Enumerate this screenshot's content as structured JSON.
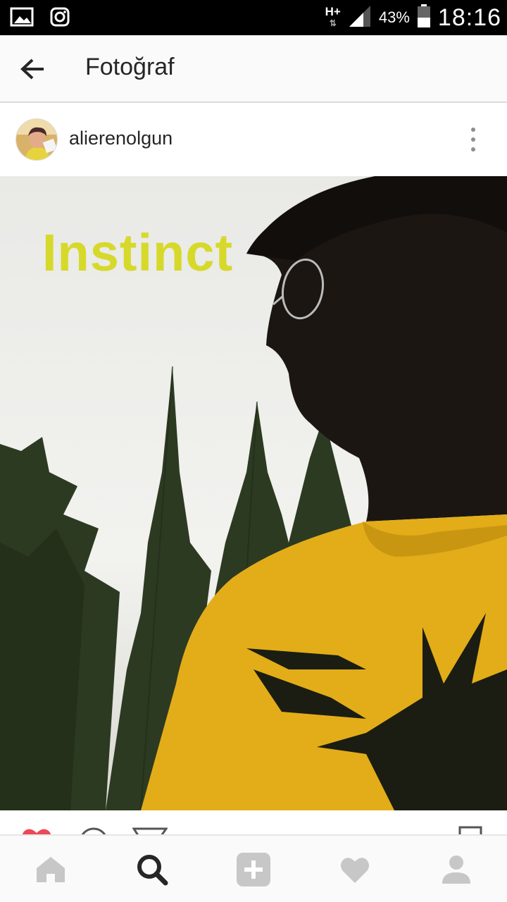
{
  "status_bar": {
    "network_type": "H+",
    "battery_percent": "43%",
    "time": "18:16",
    "icons": [
      "gallery-icon",
      "instagram-icon",
      "signal-icon",
      "battery-icon"
    ]
  },
  "header": {
    "title": "Fotoğraf",
    "back_icon": "arrow-left-icon"
  },
  "post": {
    "username": "alierenolgun",
    "menu_icon": "more-vertical-icon",
    "photo_caption": "Instinct",
    "actions": [
      "heart-icon",
      "comment-icon",
      "share-icon",
      "bookmark-icon"
    ]
  },
  "bottom_nav": {
    "items": [
      "home-icon",
      "search-icon",
      "add-icon",
      "heart-icon",
      "profile-icon"
    ],
    "active": "search-icon"
  },
  "colors": {
    "status_bar_bg": "#000000",
    "header_bg": "#fafafa",
    "caption_color": "#d6d92a",
    "shirt_yellow": "#e2ad18",
    "like_red": "#ed4956",
    "nav_inactive": "#c7c7c7",
    "nav_active": "#262626"
  }
}
